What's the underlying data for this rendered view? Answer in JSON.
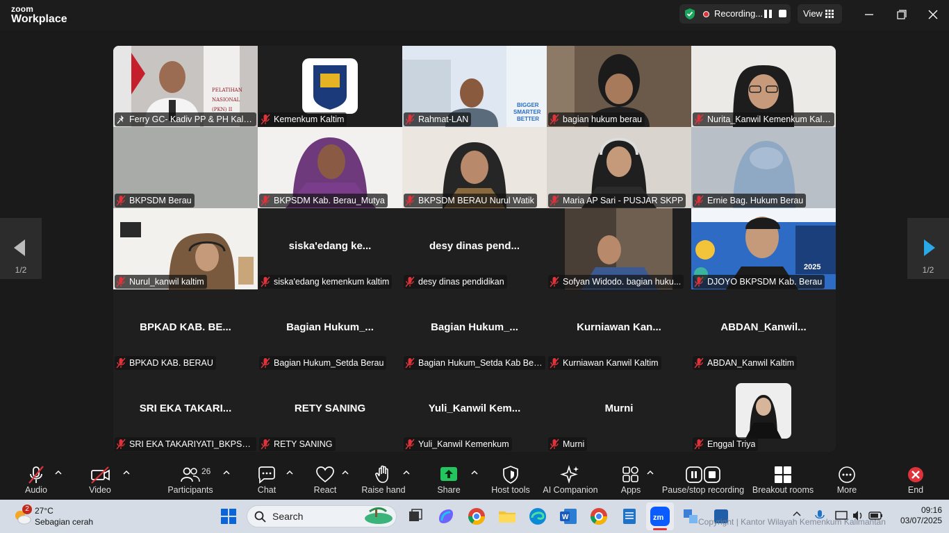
{
  "app": {
    "brand_top": "zoom",
    "brand_bottom": "Workplace"
  },
  "recording": {
    "label": "Recording...",
    "status_color": "#e0323a",
    "shield_color": "#1aa35a"
  },
  "view": {
    "label": "View"
  },
  "pager": {
    "left": "1/2",
    "right": "1/2",
    "arrow_color": "#29a9e8"
  },
  "tiles": [
    {
      "name": "Ferry GC- Kadiv PP & PH Kaltim",
      "center": "",
      "active": true
    },
    {
      "name": "Kemenkum Kaltim",
      "center": ""
    },
    {
      "name": "Rahmat-LAN",
      "center": ""
    },
    {
      "name": "bagian hukum berau",
      "center": ""
    },
    {
      "name": "Nurita_Kanwil Kemenkum Kalt...",
      "center": ""
    },
    {
      "name": "BKPSDM Berau",
      "center": ""
    },
    {
      "name": "BKPSDM Kab. Berau_Mutya",
      "center": ""
    },
    {
      "name": "BKPSDM BERAU Nurul Watik",
      "center": ""
    },
    {
      "name": "Maria AP Sari - PUSJAR SKPP",
      "center": ""
    },
    {
      "name": "Ernie Bag. Hukum Berau",
      "center": ""
    },
    {
      "name": "Nurul_kanwil kaltim",
      "center": ""
    },
    {
      "name": "siska'edang kemenkum kaltim",
      "center": "siska'edang  ke..."
    },
    {
      "name": "desy dinas pendidikan",
      "center": "desy dinas pend..."
    },
    {
      "name": "Sofyan Widodo. bagian huku...",
      "center": ""
    },
    {
      "name": "DJOYO BKPSDM Kab. Berau",
      "center": ""
    },
    {
      "name": "BPKAD KAB. BERAU",
      "center": "BPKAD KAB. BE..."
    },
    {
      "name": "Bagian Hukum_Setda Berau",
      "center": "Bagian  Hukum_..."
    },
    {
      "name": "Bagian Hukum_Setda Kab Ber...",
      "center": "Bagian  Hukum_..."
    },
    {
      "name": "Kurniawan Kanwil Kaltim",
      "center": "Kurniawan  Kan..."
    },
    {
      "name": "ABDAN_Kanwil Kaltim",
      "center": "ABDAN_Kanwil..."
    },
    {
      "name": "SRI EKA TAKARIYATI_BKPSDM ...",
      "center": "SRI EKA TAKARI..."
    },
    {
      "name": "RETY SANING",
      "center": "RETY SANING"
    },
    {
      "name": "Yuli_Kanwil Kemenkum",
      "center": "Yuli_Kanwil  Kem..."
    },
    {
      "name": "Murni",
      "center": "Murni"
    },
    {
      "name": "Enggal Triya",
      "center": ""
    }
  ],
  "toolbar": {
    "audio": "Audio",
    "video": "Video",
    "participants": "Participants",
    "participants_count": "26",
    "chat": "Chat",
    "react": "React",
    "raise_hand": "Raise hand",
    "share": "Share",
    "host_tools": "Host tools",
    "ai_companion": "AI Companion",
    "apps": "Apps",
    "pause_stop": "Pause/stop recording",
    "breakout": "Breakout rooms",
    "more": "More",
    "end": "End",
    "share_color": "#22c55e",
    "end_color": "#e0323a"
  },
  "taskbar": {
    "weather_temp": "27°C",
    "weather_cond": "Sebagian cerah",
    "weather_badge": "2",
    "search": "Search",
    "time": "09:16",
    "date": "03/07/2025",
    "watermark": "Copyright | Kantor Wilayah Kemenkum Kalimantan"
  }
}
